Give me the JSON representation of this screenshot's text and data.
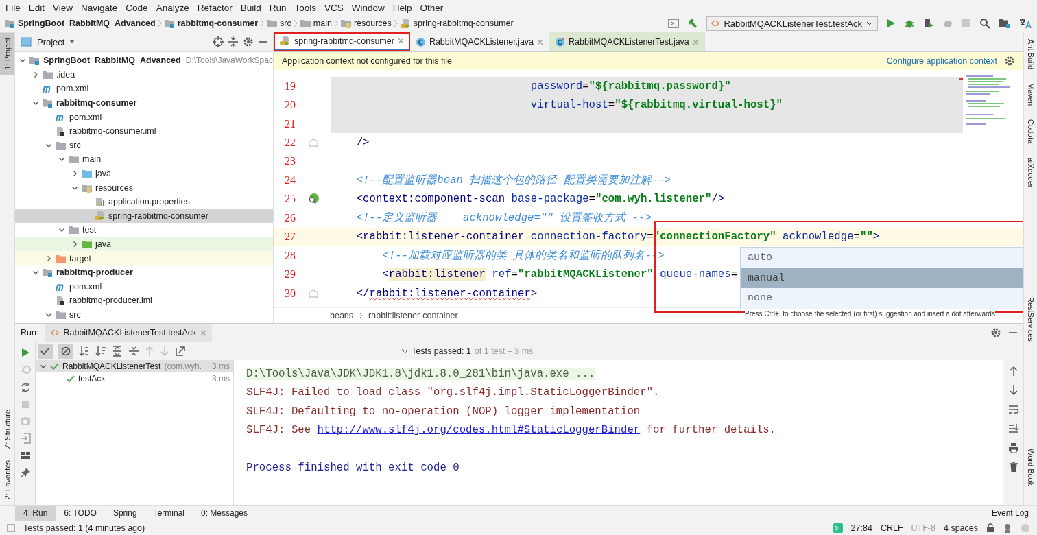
{
  "menu": [
    "File",
    "Edit",
    "View",
    "Navigate",
    "Code",
    "Analyze",
    "Refactor",
    "Build",
    "Run",
    "Tools",
    "VCS",
    "Window",
    "Help",
    "Other"
  ],
  "breadcrumbs": [
    {
      "label": "SpringBoot_RabbitMQ_Advanced",
      "kind": "module"
    },
    {
      "label": "rabbitmq-consumer",
      "kind": "module"
    },
    {
      "label": "src",
      "kind": "folder"
    },
    {
      "label": "main",
      "kind": "folder"
    },
    {
      "label": "resources",
      "kind": "resources"
    },
    {
      "label": "spring-rabbitmq-consumer",
      "kind": "spring"
    }
  ],
  "run_config": "RabbitMQACKListenerTest.testAck",
  "left_stripe": [
    {
      "label": "1: Project",
      "selected": true
    },
    {
      "label": "Z: Structure",
      "selected": false
    },
    {
      "label": "2: Favorites",
      "selected": false
    }
  ],
  "project_panel": {
    "title": "Project",
    "tree": [
      {
        "label": "SpringBoot_RabbitMQ_Advanced",
        "kind": "module",
        "path": "D:\\Tools\\JavaWorkSpac",
        "expanded": true,
        "selected": false,
        "children": [
          {
            "label": ".idea",
            "kind": "folder",
            "expanded": false,
            "selected": false
          },
          {
            "label": "pom.xml",
            "kind": "maven",
            "selected": false
          },
          {
            "label": "rabbitmq-consumer",
            "kind": "module",
            "expanded": true,
            "selected": false,
            "children": [
              {
                "label": "pom.xml",
                "kind": "maven",
                "selected": false
              },
              {
                "label": "rabbitmq-consumer.iml",
                "kind": "iml",
                "selected": false
              },
              {
                "label": "src",
                "kind": "folder",
                "expanded": true,
                "selected": false,
                "children": [
                  {
                    "label": "main",
                    "kind": "folder",
                    "expanded": true,
                    "selected": false,
                    "children": [
                      {
                        "label": "java",
                        "kind": "source-root",
                        "expanded": false,
                        "selected": false
                      },
                      {
                        "label": "resources",
                        "kind": "resources",
                        "expanded": true,
                        "selected": false,
                        "children": [
                          {
                            "label": "application.properties",
                            "kind": "properties",
                            "selected": false
                          },
                          {
                            "label": "spring-rabbitmq-consumer",
                            "kind": "spring",
                            "selected": true
                          }
                        ]
                      }
                    ]
                  },
                  {
                    "label": "test",
                    "kind": "folder",
                    "expanded": true,
                    "selected": false,
                    "children": [
                      {
                        "label": "java",
                        "kind": "test-root",
                        "expanded": false,
                        "selected": false
                      }
                    ]
                  }
                ]
              },
              {
                "label": "target",
                "kind": "excluded",
                "expanded": false,
                "selected": false
              }
            ]
          },
          {
            "label": "rabbitmq-producer",
            "kind": "module",
            "expanded": true,
            "selected": false,
            "children": [
              {
                "label": "pom.xml",
                "kind": "maven",
                "selected": false
              },
              {
                "label": "rabbitmq-producer.iml",
                "kind": "iml",
                "selected": false
              },
              {
                "label": "src",
                "kind": "folder",
                "expanded": true,
                "selected": false
              }
            ]
          }
        ]
      }
    ]
  },
  "editor_tabs": [
    {
      "label": "spring-rabbitmq-consumer",
      "kind": "spring",
      "selected": true,
      "marked": true
    },
    {
      "label": "RabbitMQACKListener.java",
      "kind": "class",
      "selected": false,
      "marked": false
    },
    {
      "label": "RabbitMQACKListenerTest.java",
      "kind": "test-class",
      "selected": false,
      "marked": false
    }
  ],
  "banner": {
    "message": "Application context not configured for this file",
    "action": "Configure application context"
  },
  "code_lines": [
    {
      "number": "19",
      "shaded": true,
      "current": false,
      "fold_marker": false,
      "bean_marker": false,
      "segments": [
        {
          "kind": "attr",
          "text": "                               password"
        },
        {
          "kind": "plain",
          "text": "="
        },
        {
          "kind": "str",
          "text": "\"${rabbitmq.password}\""
        }
      ]
    },
    {
      "number": "20",
      "shaded": true,
      "current": false,
      "fold_marker": false,
      "bean_marker": false,
      "segments": [
        {
          "kind": "attr",
          "text": "                               virtual-host"
        },
        {
          "kind": "plain",
          "text": "="
        },
        {
          "kind": "str",
          "text": "\"${rabbitmq.virtual-host}\""
        }
      ]
    },
    {
      "number": "21",
      "shaded": true,
      "current": false,
      "fold_marker": false,
      "bean_marker": false
    },
    {
      "number": "22",
      "shaded": false,
      "current": false,
      "fold_marker": true,
      "bean_marker": false,
      "segments": [
        {
          "kind": "tag",
          "text": "    />"
        }
      ]
    },
    {
      "number": "23",
      "shaded": false,
      "current": false,
      "fold_marker": false,
      "bean_marker": false
    },
    {
      "number": "24",
      "shaded": false,
      "current": false,
      "fold_marker": false,
      "bean_marker": false,
      "segments": [
        {
          "kind": "comment",
          "text": "    <!--配置监听器bean 扫描这个包的路径 配置类需要加注解-->"
        }
      ]
    },
    {
      "number": "25",
      "shaded": false,
      "current": false,
      "fold_marker": false,
      "bean_marker": true,
      "segments": [
        {
          "kind": "tag",
          "text": "    <context:component-scan"
        },
        {
          "kind": "attr",
          "text": " base-package"
        },
        {
          "kind": "plain",
          "text": "="
        },
        {
          "kind": "str",
          "text": "\"com.wyh.listener\""
        },
        {
          "kind": "tag",
          "text": "/>"
        }
      ]
    },
    {
      "number": "26",
      "shaded": false,
      "current": false,
      "fold_marker": false,
      "bean_marker": false,
      "segments": [
        {
          "kind": "comment",
          "text": "    <!--定义监听器    acknowledge=\"\" 设置签收方式 -->"
        }
      ]
    },
    {
      "number": "27",
      "shaded": false,
      "current": true,
      "fold_marker": false,
      "bean_marker": false,
      "segments": [
        {
          "kind": "tag",
          "text": "    <rabbit:listener-container"
        },
        {
          "kind": "attr",
          "text": " connection-factory"
        },
        {
          "kind": "plain",
          "text": "="
        },
        {
          "kind": "str",
          "text": "\"connectionFactory\""
        },
        {
          "kind": "attr",
          "text": " acknowledge"
        },
        {
          "kind": "plain",
          "text": "="
        },
        {
          "kind": "str",
          "text": "\"\""
        },
        {
          "kind": "tag",
          "text": ">"
        }
      ]
    },
    {
      "number": "28",
      "shaded": false,
      "current": false,
      "fold_marker": false,
      "bean_marker": false,
      "segments": [
        {
          "kind": "comment",
          "text": "        <!--加载对应监听器的类 具体的类名和监听的队列名-->"
        }
      ]
    },
    {
      "number": "29",
      "shaded": false,
      "current": false,
      "fold_marker": false,
      "bean_marker": false,
      "segments": [
        {
          "kind": "tag",
          "text": "        <"
        },
        {
          "kind": "tag-hl",
          "text": "rabbit:listener"
        },
        {
          "kind": "attr",
          "text": " ref"
        },
        {
          "kind": "plain",
          "text": "="
        },
        {
          "kind": "str",
          "text": "\"rabbitMQACKListener\""
        },
        {
          "kind": "attr",
          "text": " queue-names"
        },
        {
          "kind": "plain",
          "text": "="
        }
      ]
    },
    {
      "number": "30",
      "shaded": false,
      "current": false,
      "fold_marker": true,
      "bean_marker": false,
      "segments": [
        {
          "kind": "tag",
          "text": "    </"
        },
        {
          "kind": "tag-err",
          "text": "rabbit:listener-container"
        },
        {
          "kind": "tag",
          "text": ">"
        }
      ]
    }
  ],
  "completion": {
    "items": [
      {
        "label": "auto",
        "selected": false
      },
      {
        "label": "manual",
        "selected": true
      },
      {
        "label": "none",
        "selected": false
      }
    ],
    "hint": "Press Ctrl+. to choose the selected (or first) suggestion and insert a dot afterwards"
  },
  "editor_breadcrumbs": [
    "beans",
    "rabbit:listener-container"
  ],
  "right_stripe": [
    "Ant Build",
    "Maven",
    "Codota",
    "aiXcoder",
    "RestServices",
    "Word Book"
  ],
  "run_panel": {
    "title": "Run:",
    "tab": "RabbitMQACKListenerTest.testAck",
    "summary": "Tests passed: 1",
    "summary_detail": "of 1 test – 3 ms",
    "tests": [
      {
        "label": "RabbitMQACKListenerTest",
        "detail": "(com.wyh.",
        "time": "3 ms",
        "expanded": true,
        "selected": true,
        "children": [
          {
            "label": "testAck",
            "time": "3 ms",
            "selected": false
          }
        ]
      }
    ],
    "console": [
      {
        "kind": "cmd",
        "segments": [
          {
            "kind": "text",
            "text": "D:\\Tools\\Java\\JDK\\JDK1.8\\jdk1.8.0_281\\bin\\java.exe ..."
          }
        ]
      },
      {
        "kind": "err",
        "segments": [
          {
            "kind": "text",
            "text": "SLF4J: Failed to load class \"org.slf4j.impl.StaticLoggerBinder\"."
          }
        ]
      },
      {
        "kind": "err",
        "segments": [
          {
            "kind": "text",
            "text": "SLF4J: Defaulting to no-operation (NOP) logger implementation"
          }
        ]
      },
      {
        "kind": "err",
        "segments": [
          {
            "kind": "text",
            "text": "SLF4J: See "
          },
          {
            "kind": "link",
            "text": "http://www.slf4j.org/codes.html#StaticLoggerBinder"
          },
          {
            "kind": "text",
            "text": " for further details."
          }
        ]
      },
      {
        "kind": "info",
        "segments": [
          {
            "kind": "text",
            "text": "Process finished with exit code 0"
          }
        ]
      }
    ]
  },
  "tool_windows": [
    {
      "label": "4: Run",
      "selected": true
    },
    {
      "label": "6: TODO",
      "selected": false
    },
    {
      "label": "Spring",
      "selected": false
    },
    {
      "label": "Terminal",
      "selected": false
    },
    {
      "label": "0: Messages",
      "selected": false
    }
  ],
  "event_log": "Event Log",
  "status_bar": {
    "message": "Tests passed: 1 (4 minutes ago)",
    "position": "27:84",
    "line_separator": "CRLF",
    "encoding": "UTF-8",
    "indent": "4 spaces"
  }
}
